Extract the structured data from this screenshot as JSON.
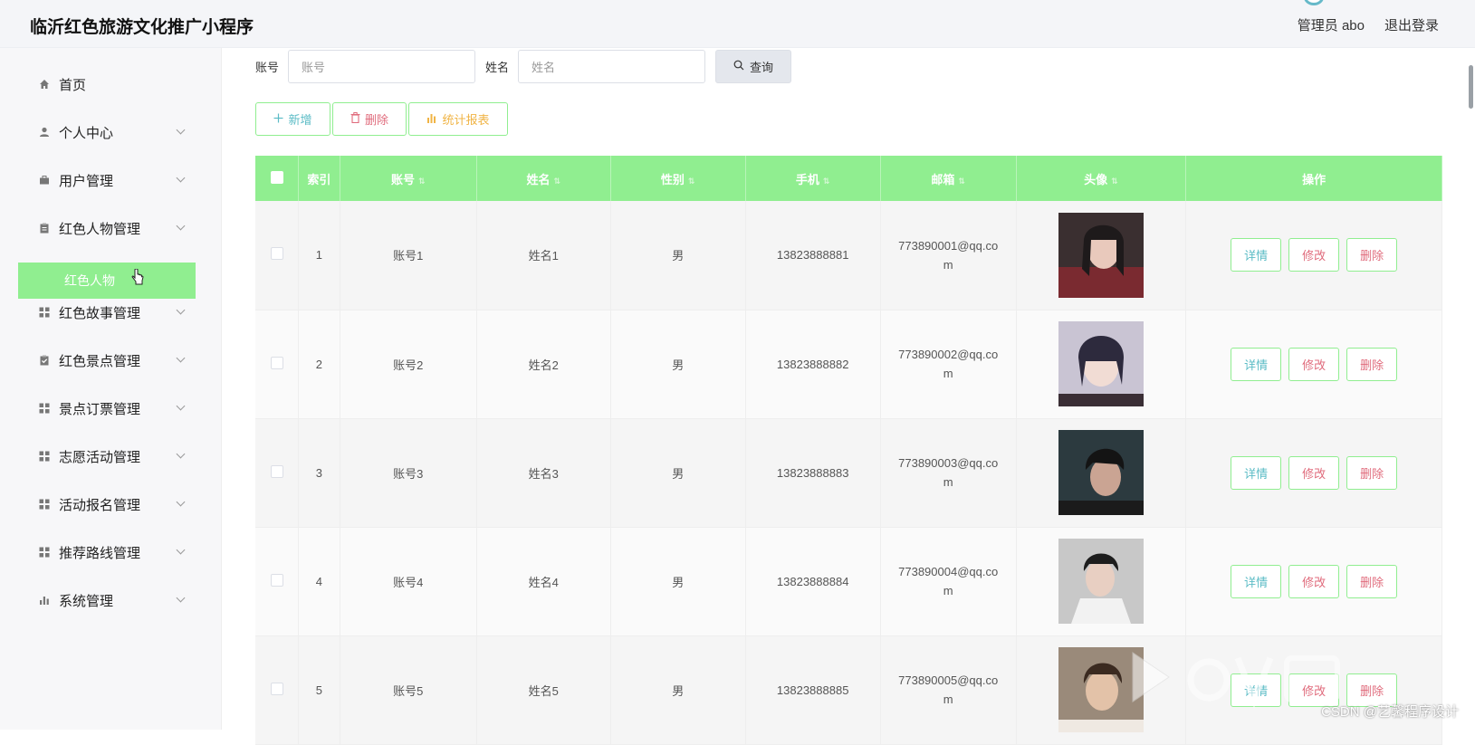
{
  "header": {
    "title": "临沂红色旅游文化推广小程序",
    "user_label": "管理员 abo",
    "logout_label": "退出登录"
  },
  "sidebar": {
    "items": [
      {
        "label": "首页",
        "icon": "home-icon"
      },
      {
        "label": "个人中心",
        "icon": "user-icon"
      },
      {
        "label": "用户管理",
        "icon": "briefcase-icon"
      },
      {
        "label": "红色人物管理",
        "icon": "clipboard-icon"
      },
      {
        "label": "红色故事管理",
        "icon": "grid-icon"
      },
      {
        "label": "红色景点管理",
        "icon": "clipboard-check-icon"
      },
      {
        "label": "景点订票管理",
        "icon": "grid-icon"
      },
      {
        "label": "志愿活动管理",
        "icon": "grid-icon"
      },
      {
        "label": "活动报名管理",
        "icon": "grid-icon"
      },
      {
        "label": "推荐路线管理",
        "icon": "grid-icon"
      },
      {
        "label": "系统管理",
        "icon": "bar-chart-icon"
      }
    ],
    "active_sub": "红色人物"
  },
  "search": {
    "account_label": "账号",
    "account_placeholder": "账号",
    "name_label": "姓名",
    "name_placeholder": "姓名",
    "query_label": "查询"
  },
  "actions": {
    "add_label": "新增",
    "delete_label": "删除",
    "stats_label": "统计报表"
  },
  "table": {
    "columns": [
      "索引",
      "账号",
      "姓名",
      "性别",
      "手机",
      "邮箱",
      "头像",
      "操作"
    ],
    "rows": [
      {
        "index": "1",
        "account": "账号1",
        "name": "姓名1",
        "gender": "男",
        "phone": "13823888881",
        "email": "773890001@qq.com"
      },
      {
        "index": "2",
        "account": "账号2",
        "name": "姓名2",
        "gender": "男",
        "phone": "13823888882",
        "email": "773890002@qq.com"
      },
      {
        "index": "3",
        "account": "账号3",
        "name": "姓名3",
        "gender": "男",
        "phone": "13823888883",
        "email": "773890003@qq.com"
      },
      {
        "index": "4",
        "account": "账号4",
        "name": "姓名4",
        "gender": "男",
        "phone": "13823888884",
        "email": "773890004@qq.com"
      },
      {
        "index": "5",
        "account": "账号5",
        "name": "姓名5",
        "gender": "男",
        "phone": "13823888885",
        "email": "773890005@qq.com"
      }
    ],
    "op_detail": "详情",
    "op_edit": "修改",
    "op_delete": "删除"
  },
  "watermark": {
    "csdn_text": "CSDN @艺馨程序设计"
  },
  "colors": {
    "accent_green": "#90ee90",
    "detail_teal": "#5cbcc6",
    "danger_pink": "#e06b7c",
    "stats_orange": "#f0b445"
  }
}
